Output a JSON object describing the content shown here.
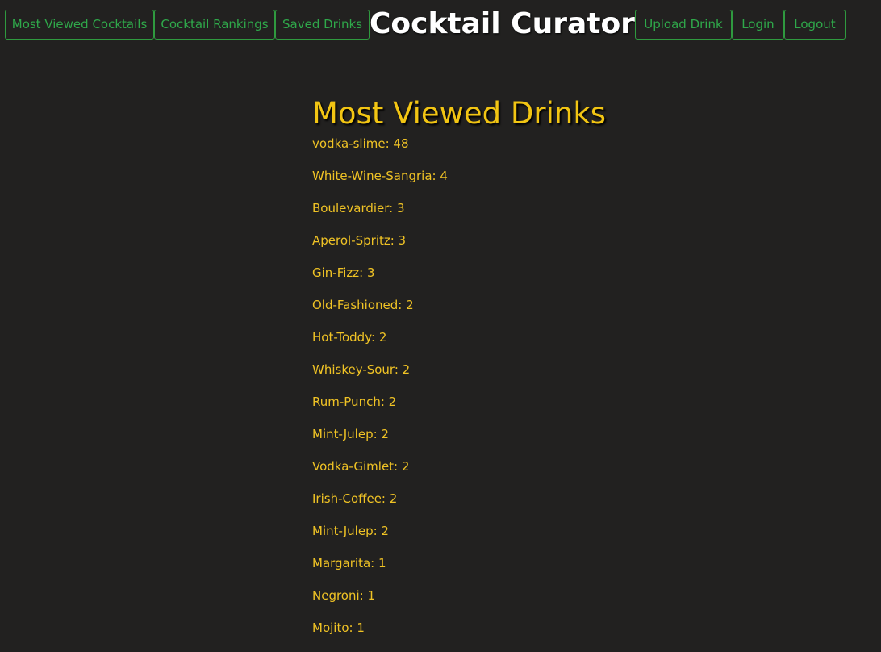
{
  "header": {
    "left_nav": [
      "Most Viewed Cocktails",
      "Cocktail Rankings",
      "Saved Drinks"
    ],
    "title": "Cocktail Curator",
    "right_nav": [
      "Upload Drink",
      "Login",
      "Logout"
    ]
  },
  "main": {
    "heading": "Most Viewed Drinks",
    "drinks": [
      {
        "name": "vodka-slime",
        "views": 48
      },
      {
        "name": "White-Wine-Sangria",
        "views": 4
      },
      {
        "name": "Boulevardier",
        "views": 3
      },
      {
        "name": "Aperol-Spritz",
        "views": 3
      },
      {
        "name": "Gin-Fizz",
        "views": 3
      },
      {
        "name": "Old-Fashioned",
        "views": 2
      },
      {
        "name": "Hot-Toddy",
        "views": 2
      },
      {
        "name": "Whiskey-Sour",
        "views": 2
      },
      {
        "name": "Rum-Punch",
        "views": 2
      },
      {
        "name": "Mint-Julep",
        "views": 2
      },
      {
        "name": "Vodka-Gimlet",
        "views": 2
      },
      {
        "name": "Irish-Coffee",
        "views": 2
      },
      {
        "name": "Mint-Julep",
        "views": 2
      },
      {
        "name": "Margarita",
        "views": 1
      },
      {
        "name": "Negroni",
        "views": 1
      },
      {
        "name": "Mojito",
        "views": 1
      }
    ]
  },
  "colors": {
    "background": "#222120",
    "nav_green": "#2fa84a",
    "accent_yellow": "#f2c513",
    "title_white": "#ffffff"
  }
}
